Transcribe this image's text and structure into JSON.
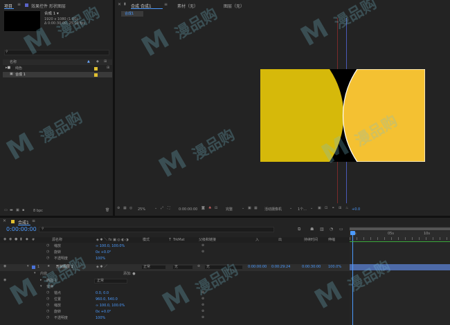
{
  "project_panel": {
    "tab_project": "项目",
    "tab_effects": "效果控件 形状图层",
    "comp_name": "合成 1 ▾",
    "comp_info1": "1920 x 1080 (1.00)",
    "comp_info2": "Δ 0:00:30:00, 25.00 fps",
    "search_placeholder": "",
    "col_name": "名称",
    "items": [
      {
        "label": "纯色",
        "color": "#e0c030"
      },
      {
        "label": "合成 1",
        "color": "#e0c030"
      }
    ],
    "bpc": "8 bpc"
  },
  "comp_viewer": {
    "tab_comp": "合成 合成1",
    "tab_footage": "素材（无）",
    "tab_layer": "图层（无）",
    "breadcrumb": "合成1",
    "zoom": "25%",
    "timecode": "0:00:00:00",
    "resolution": "完整",
    "camera": "活动摄像机",
    "views": "1个...",
    "exposure": "+0.0",
    "colors": {
      "left_fill": "#d6b90a",
      "right_fill": "#f4c132",
      "background": "#000000"
    }
  },
  "timeline": {
    "tab_label": "合成1",
    "timecode": "0:00:00:00",
    "columns": [
      "源名称",
      "模式",
      "T",
      "TrkMat",
      "父级和链接",
      "入",
      "出",
      "持续时间",
      "伸缩"
    ],
    "ruler": [
      "0s",
      "05s",
      "10s"
    ],
    "rows": [
      {
        "label": "缩放",
        "value": "∞ 100.0, 100.0%"
      },
      {
        "label": "旋转",
        "value": "0x +0.0°"
      },
      {
        "label": "不透明度",
        "value": "100%"
      },
      {
        "label": "形状图层 1",
        "mode": "正常",
        "trk": "无",
        "parent": "无",
        "in": "0:00:00:00",
        "out": "0:00:29:24",
        "dur": "0:00:30:00",
        "stretch": "100.0%"
      },
      {
        "label": "内容",
        "add": "添加: ●"
      },
      {
        "label": "椭圆 1",
        "mode": "正常"
      },
      {
        "label": "变换"
      },
      {
        "label": "锚点",
        "value": "0.0, 0.0"
      },
      {
        "label": "位置",
        "value": "960.0, 540.0"
      },
      {
        "label": "缩放",
        "value": "∞ 100.0, 100.0%"
      },
      {
        "label": "旋转",
        "value": "0x +0.0°"
      },
      {
        "label": "不透明度",
        "value": "100%"
      }
    ]
  },
  "watermark": "漫品购"
}
